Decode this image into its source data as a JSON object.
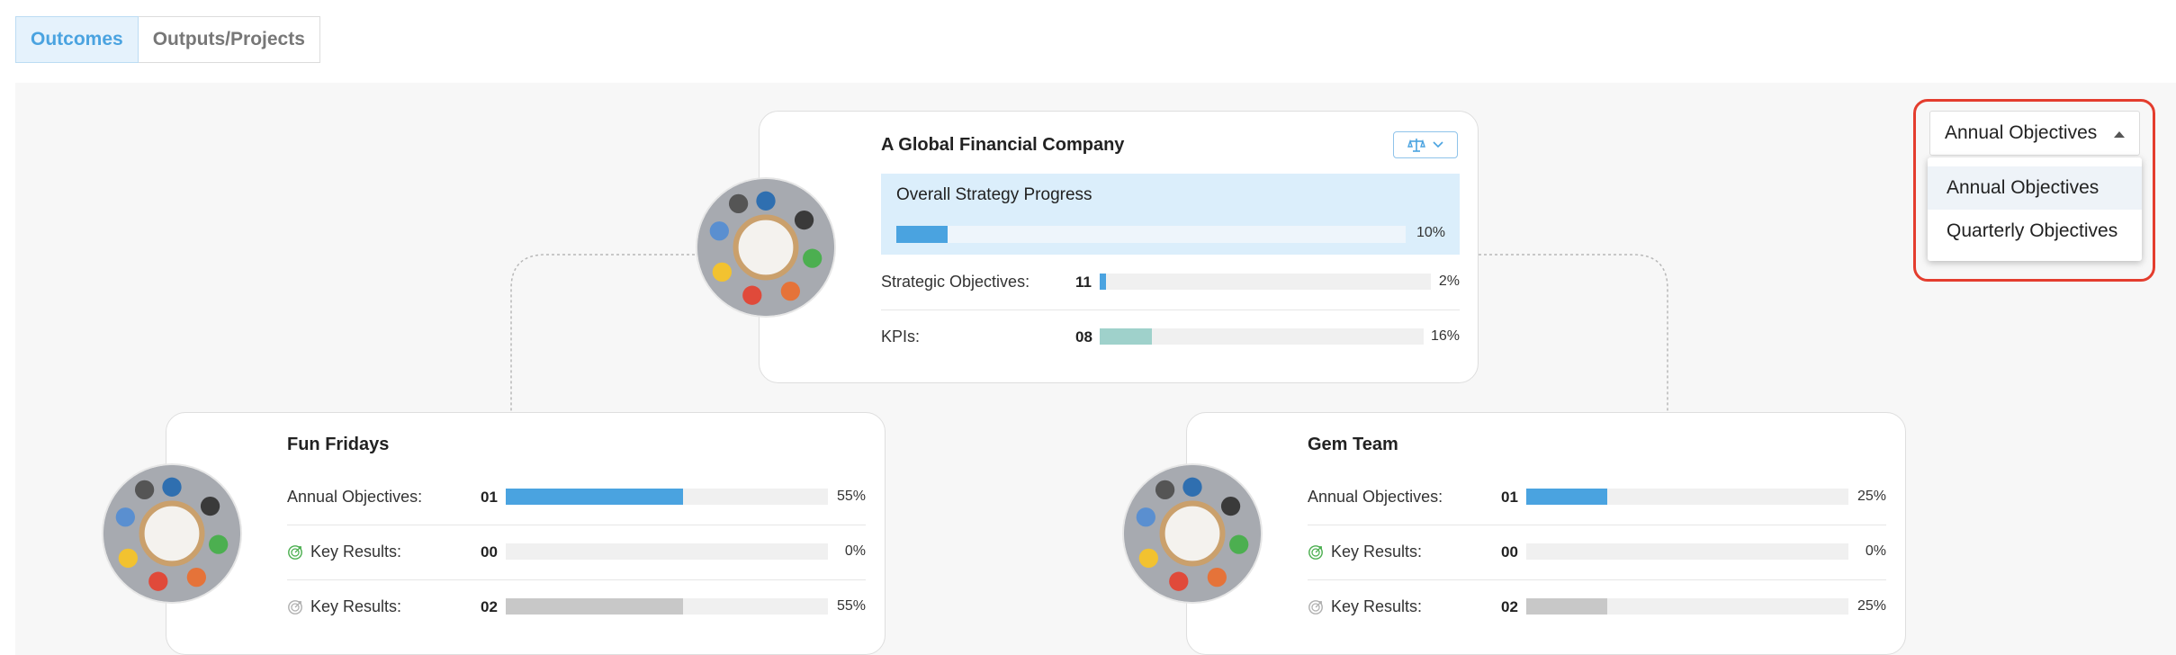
{
  "tabs": [
    {
      "label": "Outcomes",
      "active": true
    },
    {
      "label": "Outputs/Projects",
      "active": false
    }
  ],
  "dropdown": {
    "selected": "Annual Objectives",
    "options": [
      "Annual Objectives",
      "Quarterly Objectives"
    ]
  },
  "root": {
    "title": "A Global Financial Company",
    "overall": {
      "label": "Overall Strategy Progress",
      "value": 0.1,
      "pct": "10%"
    },
    "rows": [
      {
        "label": "Strategic Objectives:",
        "count": "11",
        "value": 0.02,
        "pct": "2%",
        "color": "#4aa3e0"
      },
      {
        "label": "KPIs:",
        "count": "08",
        "value": 0.16,
        "pct": "16%",
        "color": "#9fd1cb"
      }
    ]
  },
  "teams": [
    {
      "title": "Fun Fridays",
      "rows": [
        {
          "label": "Annual Objectives:",
          "count": "01",
          "value": 0.55,
          "pct": "55%",
          "color": "#4aa3e0",
          "icon": ""
        },
        {
          "label": "Key Results:",
          "count": "00",
          "value": 0.0,
          "pct": "0%",
          "color": "#4caf50",
          "icon": "target-green-icon"
        },
        {
          "label": "Key Results:",
          "count": "02",
          "value": 0.55,
          "pct": "55%",
          "color": "#c8c8c8",
          "icon": "target-gray-icon"
        }
      ]
    },
    {
      "title": "Gem Team",
      "rows": [
        {
          "label": "Annual Objectives:",
          "count": "01",
          "value": 0.25,
          "pct": "25%",
          "color": "#4aa3e0",
          "icon": ""
        },
        {
          "label": "Key Results:",
          "count": "00",
          "value": 0.0,
          "pct": "0%",
          "color": "#4caf50",
          "icon": "target-green-icon"
        },
        {
          "label": "Key Results:",
          "count": "02",
          "value": 0.25,
          "pct": "25%",
          "color": "#c8c8c8",
          "icon": "target-gray-icon"
        }
      ]
    }
  ],
  "icons": {
    "filter": "scale-filter-icon",
    "chevron": "chevron-down-icon",
    "caret": "caret-up-icon"
  }
}
